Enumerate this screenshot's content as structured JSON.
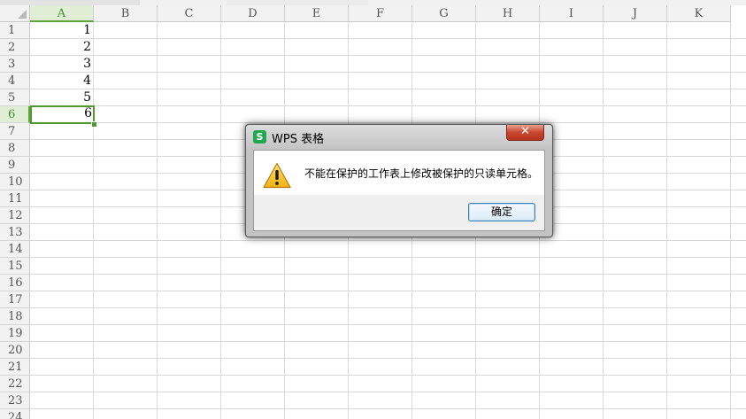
{
  "sheet": {
    "columns": [
      "A",
      "B",
      "C",
      "D",
      "E",
      "F",
      "G",
      "H",
      "I",
      "J",
      "K"
    ],
    "rows": [
      "1",
      "2",
      "3",
      "4",
      "5",
      "6",
      "7",
      "8",
      "9",
      "10",
      "11",
      "12",
      "13",
      "14",
      "15",
      "16",
      "17",
      "18",
      "19",
      "20",
      "21",
      "22",
      "23",
      "24"
    ],
    "selected_column": "A",
    "selected_row": "6",
    "cells_col_a": [
      "1",
      "2",
      "3",
      "4",
      "5",
      "6"
    ]
  },
  "dialog": {
    "title": "WPS 表格",
    "app_icon": "S",
    "close_glyph": "✕",
    "message": "不能在保护的工作表上修改被保护的只读单元格。",
    "ok_label": "确定",
    "warning_icon": "warning-triangle-icon"
  },
  "colors": {
    "selection": "#4e9a2f",
    "header_bg": "#f2f2f2",
    "app_icon": "#21a74f",
    "close_button": "#c9462e"
  }
}
